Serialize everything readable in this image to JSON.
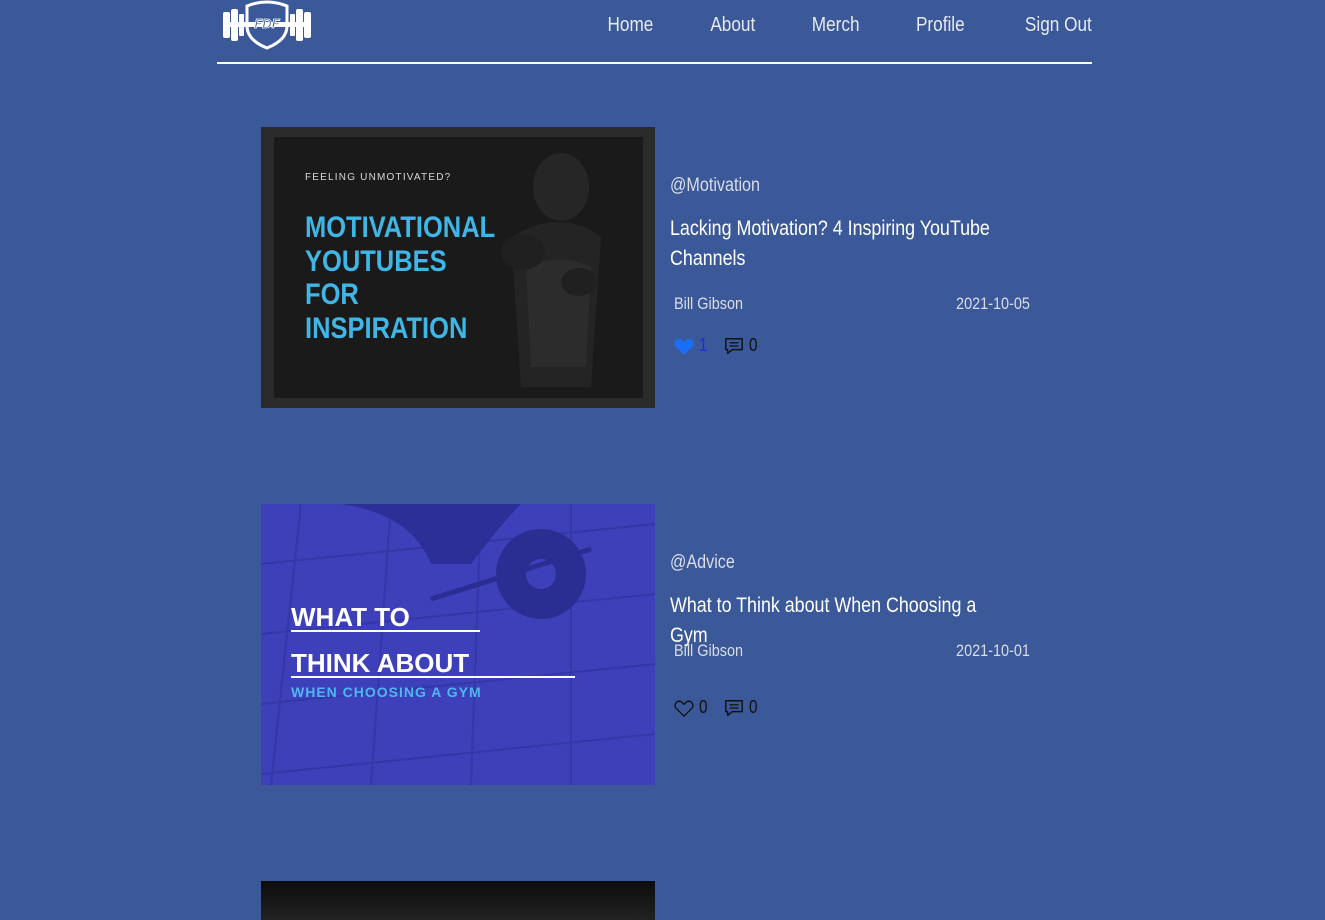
{
  "colors": {
    "background": "#3b5998",
    "liked_heart": "#1a6ef5",
    "liked_count": "#2222ff",
    "count_default": "#111111"
  },
  "nav": {
    "items": [
      {
        "label": "Home"
      },
      {
        "label": "About"
      },
      {
        "label": "Merch"
      },
      {
        "label": "Profile"
      },
      {
        "label": "Sign Out"
      }
    ]
  },
  "logo": {
    "icon": "dumbbell-shield-logo",
    "text": "FDF"
  },
  "posts": [
    {
      "tag": "@Motivation",
      "title": "Lacking Motivation? 4 Inspiring YouTube Channels",
      "author": "Bill Gibson",
      "date": "2021-10-05",
      "likes": "1",
      "comments": "0",
      "liked": true,
      "image": {
        "kicker": "FEELING UNMOTIVATED?",
        "lines": [
          "MOTIVATIONAL",
          "YOUTUBES",
          "FOR",
          "INSPIRATION"
        ]
      }
    },
    {
      "tag": "@Advice",
      "title": "What to Think about When Choosing a Gym",
      "author": "Bill Gibson",
      "date": "2021-10-01",
      "likes": "0",
      "comments": "0",
      "liked": false,
      "image": {
        "lines": [
          "WHAT TO",
          "THINK ABOUT"
        ],
        "sub": "WHEN CHOOSING A GYM"
      }
    }
  ]
}
